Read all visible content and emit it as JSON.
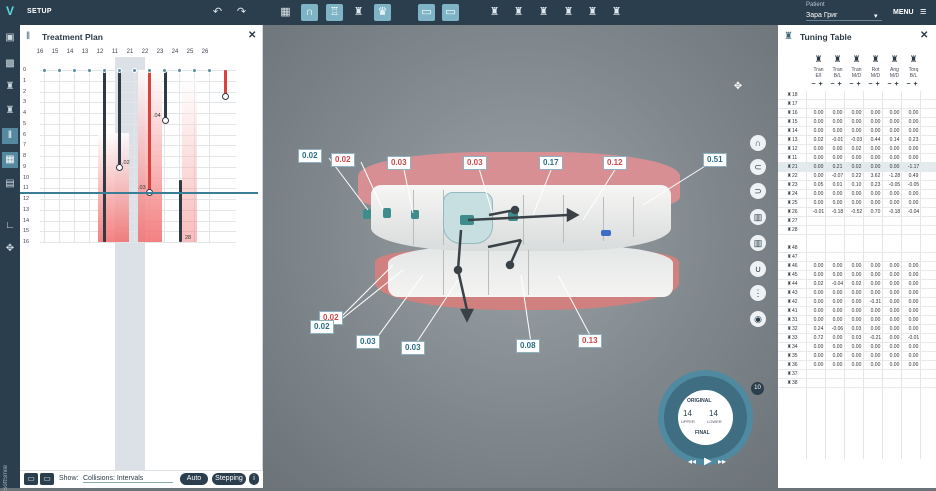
{
  "app": {
    "logo": "V",
    "mode_label": "SETUP"
  },
  "patient": {
    "label": "Patient",
    "name": "Зара Григ"
  },
  "menu_label": "MENU",
  "treatment_plan": {
    "title": "Treatment Plan",
    "columns": [
      "16",
      "15",
      "14",
      "13",
      "12",
      "11",
      "21",
      "22",
      "23",
      "24",
      "25",
      "26"
    ],
    "rows": [
      "0",
      "1",
      "2",
      "3",
      "4",
      "5",
      "6",
      "7",
      "8",
      "9",
      "10",
      "11",
      "12",
      "13",
      "14",
      "15",
      "16"
    ],
    "highlighted_column": "21",
    "values": [
      ".02",
      ".03",
      ".04",
      "28"
    ],
    "show_label": "Show:",
    "show_value": "Collisions: Intervals",
    "auto_button": "Auto",
    "stepping_button": "Stepping"
  },
  "viewport": {
    "callouts": [
      {
        "text": "0.02",
        "color": "blue"
      },
      {
        "text": "0.02",
        "color": "red"
      },
      {
        "text": "0.03",
        "color": "red"
      },
      {
        "text": "0.03",
        "color": "red"
      },
      {
        "text": "0.17",
        "color": "blue"
      },
      {
        "text": "0.12",
        "color": "red"
      },
      {
        "text": "0.51",
        "color": "blue"
      },
      {
        "text": "0.02",
        "color": "red"
      },
      {
        "text": "0.02",
        "color": "blue"
      },
      {
        "text": "0.03",
        "color": "blue"
      },
      {
        "text": "0.03",
        "color": "blue"
      },
      {
        "text": "0.08",
        "color": "blue"
      },
      {
        "text": "0.13",
        "color": "red"
      }
    ],
    "stage_dial": {
      "original": "ORIGINAL",
      "final": "FINAL",
      "upper_count": "14",
      "lower_count": "14",
      "upper_label": "UPPER",
      "lower_label": "LOWER",
      "stage": "10"
    }
  },
  "tuning_table": {
    "title": "Tuning Table",
    "columns": [
      {
        "line1": "Tran",
        "line2": "E/I"
      },
      {
        "line1": "Tran",
        "line2": "B/L"
      },
      {
        "line1": "Tran",
        "line2": "M/D"
      },
      {
        "line1": "Rot",
        "line2": "M/D"
      },
      {
        "line1": "Ang",
        "line2": "M/D"
      },
      {
        "line1": "Torq",
        "line2": "B/L"
      }
    ],
    "upper_rows": [
      {
        "tooth": "18",
        "v": [
          "",
          "",
          "",
          "",
          "",
          ""
        ]
      },
      {
        "tooth": "17",
        "v": [
          "",
          "",
          "",
          "",
          "",
          ""
        ]
      },
      {
        "tooth": "16",
        "v": [
          "0.00",
          "0.00",
          "0.00",
          "0.00",
          "0.00",
          "0.00"
        ]
      },
      {
        "tooth": "15",
        "v": [
          "0.00",
          "0.00",
          "0.00",
          "0.00",
          "0.00",
          "0.00"
        ]
      },
      {
        "tooth": "14",
        "v": [
          "0.00",
          "0.00",
          "0.00",
          "0.00",
          "0.00",
          "0.00"
        ]
      },
      {
        "tooth": "13",
        "v": [
          "0.02",
          "-0.01",
          "-0.03",
          "0.44",
          "0.14",
          "0.23"
        ]
      },
      {
        "tooth": "12",
        "v": [
          "0.00",
          "0.00",
          "0.02",
          "0.00",
          "0.00",
          "0.00"
        ]
      },
      {
        "tooth": "11",
        "v": [
          "0.00",
          "0.00",
          "0.00",
          "0.00",
          "0.00",
          "0.00"
        ]
      },
      {
        "tooth": "21",
        "v": [
          "0.00",
          "0.21",
          "0.02",
          "0.00",
          "0.00",
          "-1.17"
        ]
      },
      {
        "tooth": "22",
        "v": [
          "0.00",
          "-0.07",
          "0.22",
          "3.62",
          "-1.28",
          "0.49"
        ]
      },
      {
        "tooth": "23",
        "v": [
          "0.05",
          "0.01",
          "0.10",
          "0.23",
          "-0.05",
          "-0.05"
        ]
      },
      {
        "tooth": "24",
        "v": [
          "0.00",
          "0.00",
          "0.00",
          "0.00",
          "0.00",
          "0.00"
        ]
      },
      {
        "tooth": "25",
        "v": [
          "0.00",
          "0.00",
          "0.00",
          "0.00",
          "0.00",
          "0.00"
        ]
      },
      {
        "tooth": "26",
        "v": [
          "-0.01",
          "-0.18",
          "-0.52",
          "0.70",
          "-0.18",
          "-0.04"
        ]
      },
      {
        "tooth": "27",
        "v": [
          "",
          "",
          "",
          "",
          "",
          ""
        ]
      },
      {
        "tooth": "28",
        "v": [
          "",
          "",
          "",
          "",
          "",
          ""
        ]
      }
    ],
    "lower_rows": [
      {
        "tooth": "48",
        "v": [
          "",
          "",
          "",
          "",
          "",
          ""
        ]
      },
      {
        "tooth": "47",
        "v": [
          "",
          "",
          "",
          "",
          "",
          ""
        ]
      },
      {
        "tooth": "46",
        "v": [
          "0.00",
          "0.00",
          "0.00",
          "0.00",
          "0.00",
          "0.00"
        ]
      },
      {
        "tooth": "45",
        "v": [
          "0.00",
          "0.00",
          "0.00",
          "0.00",
          "0.00",
          "0.00"
        ]
      },
      {
        "tooth": "44",
        "v": [
          "0.02",
          "-0.04",
          "0.02",
          "0.00",
          "0.00",
          "0.00"
        ]
      },
      {
        "tooth": "43",
        "v": [
          "0.00",
          "0.00",
          "0.00",
          "0.00",
          "0.00",
          "0.00"
        ]
      },
      {
        "tooth": "42",
        "v": [
          "0.00",
          "0.00",
          "0.00",
          "-0.31",
          "0.00",
          "0.00"
        ]
      },
      {
        "tooth": "41",
        "v": [
          "0.00",
          "0.00",
          "0.00",
          "0.00",
          "0.00",
          "0.00"
        ]
      },
      {
        "tooth": "31",
        "v": [
          "0.00",
          "0.00",
          "0.00",
          "0.00",
          "0.00",
          "0.00"
        ]
      },
      {
        "tooth": "32",
        "v": [
          "0.24",
          "-0.06",
          "0.03",
          "0.00",
          "0.00",
          "0.00"
        ]
      },
      {
        "tooth": "33",
        "v": [
          "0.72",
          "0.00",
          "0.03",
          "-0.21",
          "0.00",
          "-0.01"
        ]
      },
      {
        "tooth": "34",
        "v": [
          "0.00",
          "0.00",
          "0.00",
          "0.00",
          "0.00",
          "0.00"
        ]
      },
      {
        "tooth": "35",
        "v": [
          "0.00",
          "0.00",
          "0.00",
          "0.00",
          "0.00",
          "0.00"
        ]
      },
      {
        "tooth": "36",
        "v": [
          "0.00",
          "0.00",
          "0.00",
          "0.00",
          "0.00",
          "0.00"
        ]
      },
      {
        "tooth": "37",
        "v": [
          "",
          "",
          "",
          "",
          "",
          ""
        ]
      },
      {
        "tooth": "38",
        "v": [
          "",
          "",
          "",
          "",
          "",
          ""
        ]
      }
    ]
  },
  "colors": {
    "brand_dark": "#2b3e4d",
    "accent": "#5fd6e0",
    "active": "#7fb4c7",
    "red": "#d9423f",
    "blue_callout": "#2b6d87"
  },
  "brand": "SoftSmile"
}
